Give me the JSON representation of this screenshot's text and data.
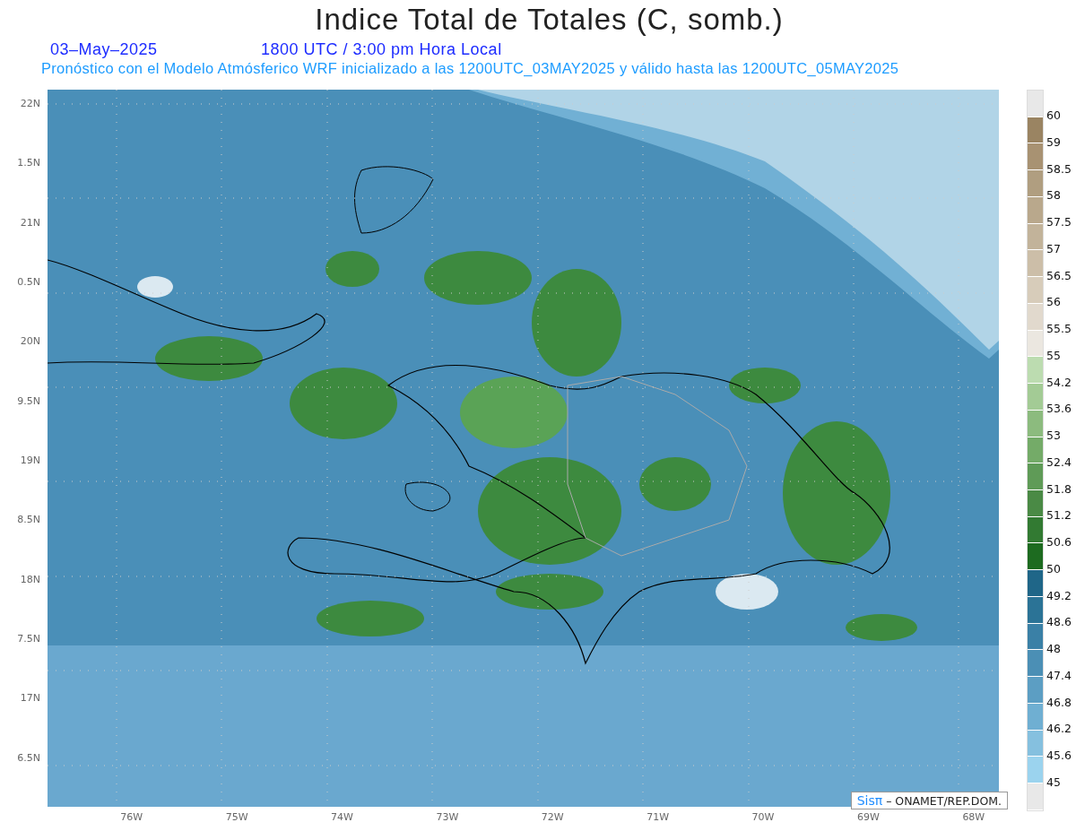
{
  "title": "Indice Total de Totales (C, somb.)",
  "date": "03–May–2025",
  "time": "1800 UTC / 3:00 pm Hora Local",
  "subtitle": "Pronóstico con el Modelo Atmósferico WRF inicializado a las 1200UTC_03MAY2025 y válido hasta las  1200UTC_05MAY2025",
  "lat_labels": [
    "22N",
    "1.5N",
    "21N",
    "0.5N",
    "20N",
    "9.5N",
    "19N",
    "8.5N",
    "18N",
    "7.5N",
    "17N",
    "6.5N"
  ],
  "lon_labels": [
    "76W",
    "75W",
    "74W",
    "73W",
    "72W",
    "71W",
    "70W",
    "69W",
    "68W"
  ],
  "colorbar": {
    "bins": [
      {
        "color": "#e8e8e8"
      },
      {
        "color": "#9a8462"
      },
      {
        "color": "#a89272"
      },
      {
        "color": "#b09e80"
      },
      {
        "color": "#b9a88c"
      },
      {
        "color": "#c2b39a"
      },
      {
        "color": "#ccbea8"
      },
      {
        "color": "#d7ccba"
      },
      {
        "color": "#e1d9cd"
      },
      {
        "color": "#ebe7e0"
      },
      {
        "color": "#bcdcb0"
      },
      {
        "color": "#a3cb95"
      },
      {
        "color": "#8cbb7e"
      },
      {
        "color": "#74ab68"
      },
      {
        "color": "#5f9b57"
      },
      {
        "color": "#4a8a45"
      },
      {
        "color": "#327a32"
      },
      {
        "color": "#1d6b20"
      },
      {
        "color": "#1f6688"
      },
      {
        "color": "#2b7396"
      },
      {
        "color": "#3a80a6"
      },
      {
        "color": "#4b8fb5"
      },
      {
        "color": "#5c9ec3"
      },
      {
        "color": "#6fafd2"
      },
      {
        "color": "#85c0df"
      },
      {
        "color": "#9bd3ee"
      },
      {
        "color": "#e8e8e8"
      }
    ],
    "labels": [
      "60",
      "59",
      "58.5",
      "58",
      "57.5",
      "57",
      "56.5",
      "56",
      "55.5",
      "55",
      "54.2",
      "53.6",
      "53",
      "52.4",
      "51.8",
      "51.2",
      "50.6",
      "50",
      "49.2",
      "48.6",
      "48",
      "47.4",
      "46.8",
      "46.2",
      "45.6",
      "45"
    ]
  },
  "credit": {
    "logo": "Sisπ",
    "text": "– ONAMET/REP.DOM."
  }
}
